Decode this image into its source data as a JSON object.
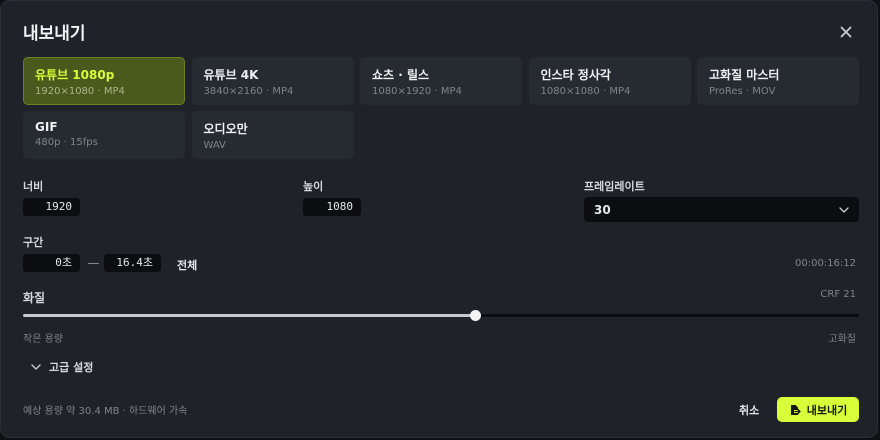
{
  "dialog": {
    "title": "내보내기",
    "close_icon": "close-icon"
  },
  "presets": [
    {
      "name": "유튜브 1080p",
      "sub": "1920×1080 · MP4",
      "active": true
    },
    {
      "name": "유튜브 4K",
      "sub": "3840×2160 · MP4",
      "active": false
    },
    {
      "name": "쇼츠 · 릴스",
      "sub": "1080×1920 · MP4",
      "active": false
    },
    {
      "name": "인스타 정사각",
      "sub": "1080×1080 · MP4",
      "active": false
    },
    {
      "name": "고화질 마스터",
      "sub": "ProRes · MOV",
      "active": false
    },
    {
      "name": "GIF",
      "sub": "480p · 15fps",
      "active": false
    },
    {
      "name": "오디오만",
      "sub": "WAV",
      "active": false
    }
  ],
  "dimensions": {
    "width_label": "너비",
    "width_value": "1920",
    "height_label": "높이",
    "height_value": "1080",
    "framerate_label": "프레임레이트",
    "framerate_value": "30"
  },
  "range": {
    "label": "구간",
    "start": "0초",
    "end": "16.4초",
    "all_label": "전체",
    "duration": "00:00:16:12"
  },
  "quality": {
    "label": "화질",
    "crf": "CRF 21",
    "level": 0.541,
    "left_hint": "작은 용량",
    "right_hint": "고화질"
  },
  "advanced": {
    "label": "고급 설정",
    "icon": "chevron-down-icon"
  },
  "footer": {
    "estimate": "예상 용량 약 30.4 MB · 하드웨어 가속",
    "cancel_label": "취소",
    "export_label": "내보내기",
    "export_icon": "export-file-icon"
  },
  "colors": {
    "accent": "#d7ff3a",
    "active_preset_bg": "#4a5a1c",
    "dialog_bg": "#1f2228"
  }
}
